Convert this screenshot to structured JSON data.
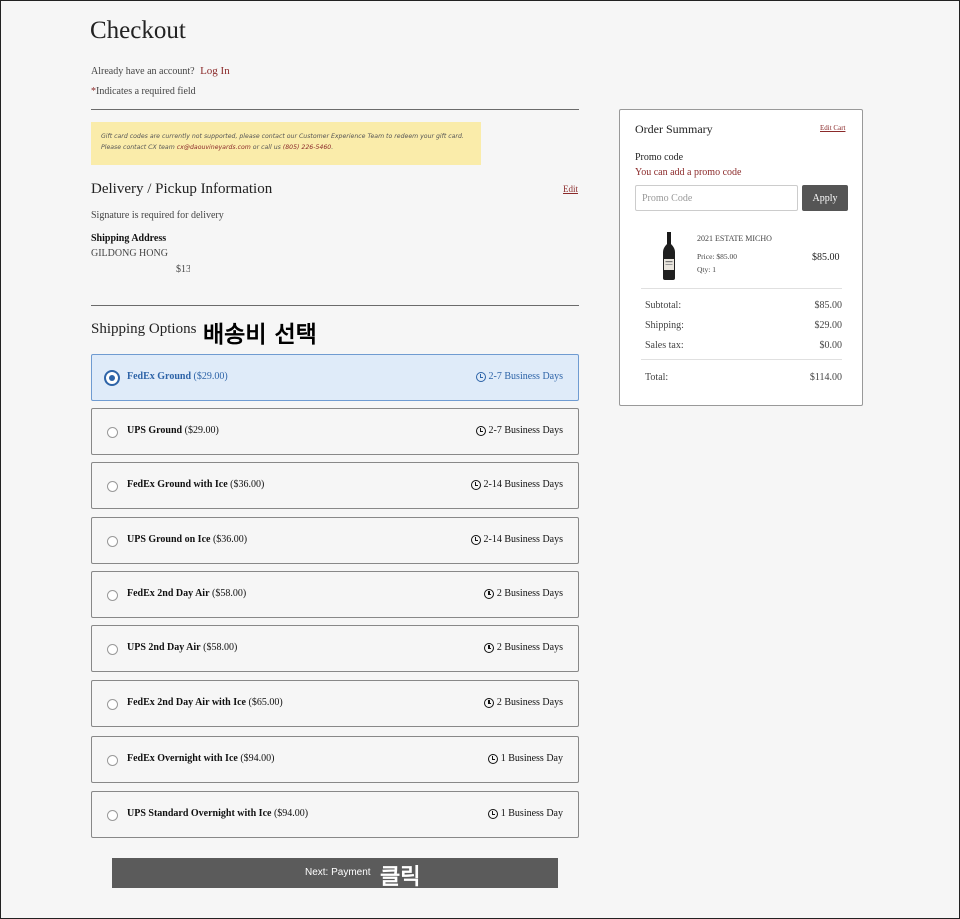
{
  "header": {
    "title": "Checkout",
    "account_prompt": "Already have an account?",
    "login_link": "Log In",
    "required_star": "*",
    "required_note": "Indicates a required field"
  },
  "notice": {
    "line1": "Gift card codes are currently not supported, please contact our Customer Experience Team to redeem your gift card.",
    "line2_pre": "Please contact CX team ",
    "email": "cx@daouvineyards.com",
    "line2_mid": " or call us ",
    "phone": "(805) 226-5460",
    "line2_end": "."
  },
  "delivery": {
    "title": "Delivery / Pickup Information",
    "edit_label": "Edit",
    "signature_note": "Signature is required for delivery",
    "shipping_address_label": "Shipping Address",
    "name": "GILDONG HONG",
    "address_fragment": "$13("
  },
  "shipping": {
    "title": "Shipping Options",
    "annotation": "배송비 선택",
    "options": [
      {
        "name": "FedEx Ground",
        "price": "($29.00)",
        "days": "2-7 Business Days",
        "selected": true
      },
      {
        "name": "UPS Ground",
        "price": "($29.00)",
        "days": "2-7 Business Days",
        "selected": false
      },
      {
        "name": "FedEx Ground with Ice",
        "price": "($36.00)",
        "days": "2-14 Business Days",
        "selected": false
      },
      {
        "name": "UPS Ground on Ice",
        "price": "($36.00)",
        "days": "2-14 Business Days",
        "selected": false
      },
      {
        "name": "FedEx 2nd Day Air",
        "price": "($58.00)",
        "days": "2 Business Days",
        "selected": false
      },
      {
        "name": "UPS 2nd Day Air",
        "price": "($58.00)",
        "days": "2 Business Days",
        "selected": false
      },
      {
        "name": "FedEx 2nd Day Air with Ice",
        "price": "($65.00)",
        "days": "2 Business Days",
        "selected": false
      },
      {
        "name": "FedEx Overnight with Ice",
        "price": "($94.00)",
        "days": "1 Business Day",
        "selected": false
      },
      {
        "name": "UPS Standard Overnight with Ice",
        "price": "($94.00)",
        "days": "1 Business Day",
        "selected": false
      }
    ]
  },
  "next_button": {
    "label": "Next: Payment",
    "annotation": "클릭"
  },
  "summary": {
    "title": "Order Summary",
    "edit_cart": "Edit Cart",
    "promo_label": "Promo code",
    "promo_link": "You can add a promo code",
    "promo_placeholder": "Promo Code",
    "apply_label": "Apply",
    "product": {
      "name": "2021 ESTATE MICHO",
      "price": "Price: $85.00",
      "qty": "Qty: 1",
      "total": "$85.00"
    },
    "rows": {
      "subtotal_label": "Subtotal:",
      "subtotal": "$85.00",
      "shipping_label": "Shipping:",
      "shipping": "$29.00",
      "tax_label": "Sales tax:",
      "tax": "$0.00",
      "total_label": "Total:",
      "total": "$114.00"
    }
  },
  "colors": {
    "accent_link": "#8b2a2a",
    "selected_blue": "#2e64a8",
    "selected_bg": "#dfebf9",
    "notice_bg": "#faecaa",
    "button_gray": "#5b5b5b"
  }
}
